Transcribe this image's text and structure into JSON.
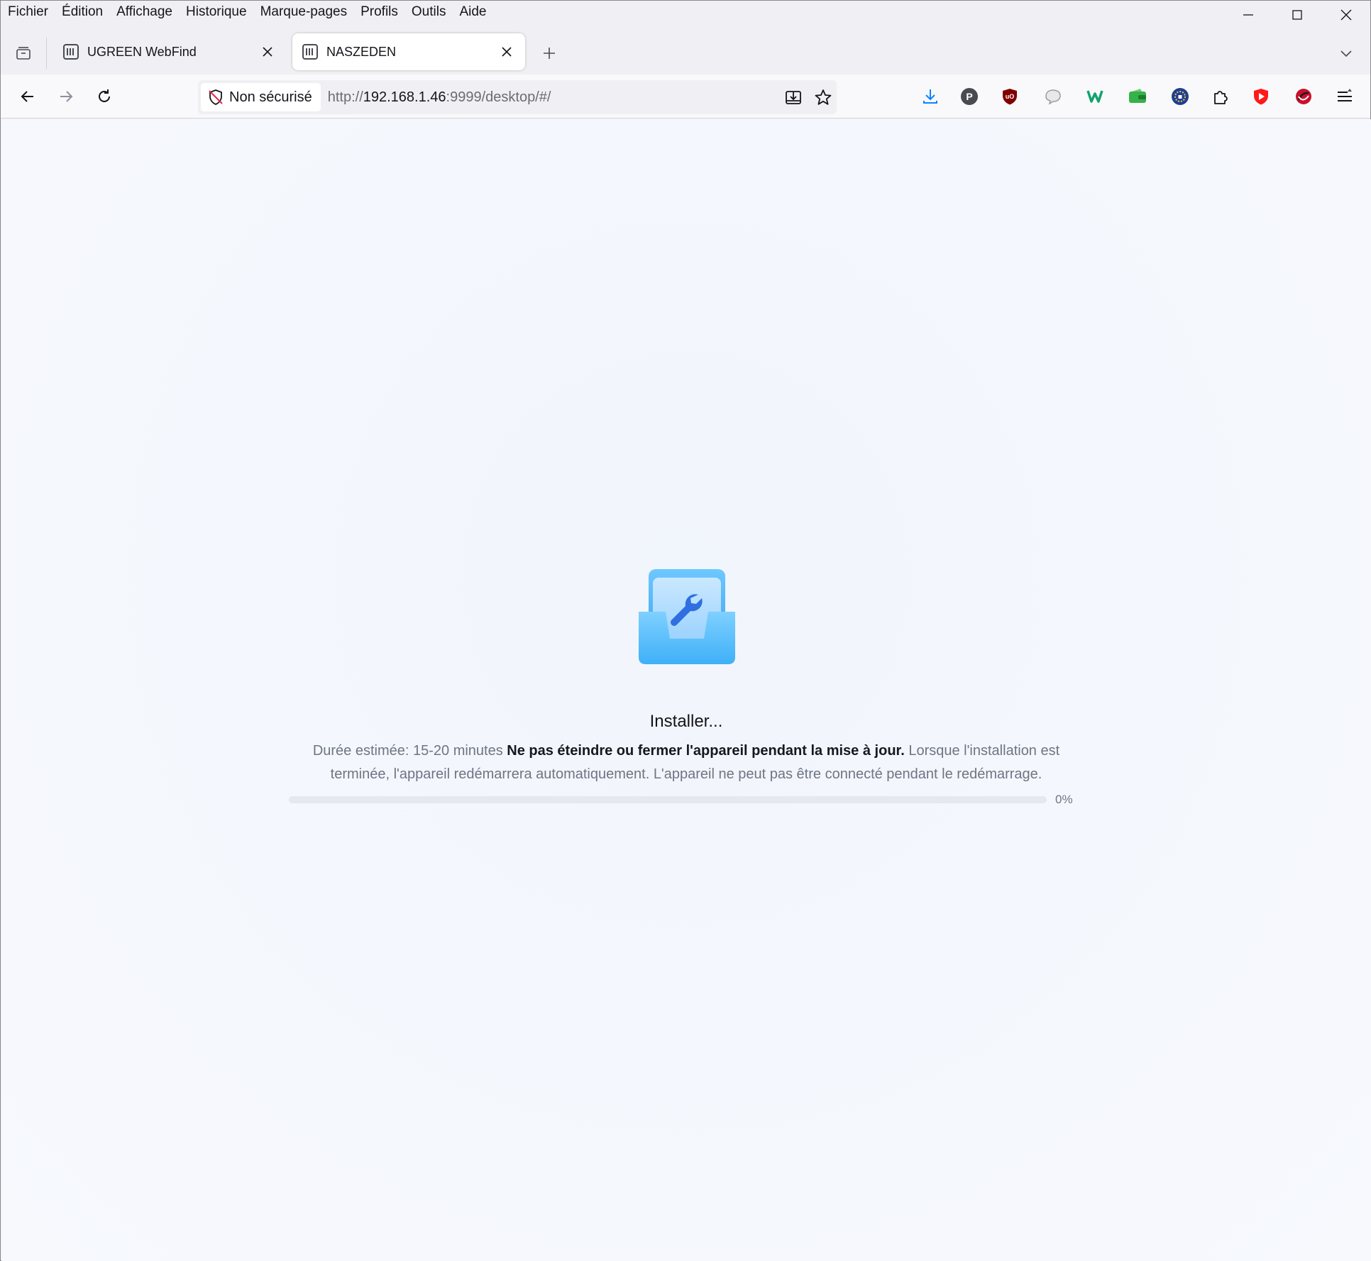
{
  "menubar": {
    "items": [
      "Fichier",
      "Édition",
      "Affichage",
      "Historique",
      "Marque-pages",
      "Profils",
      "Outils",
      "Aide"
    ]
  },
  "tabs": [
    {
      "title": "UGREEN WebFind",
      "active": false,
      "icon": "nas-favicon-icon"
    },
    {
      "title": "NASZEDEN",
      "active": true,
      "icon": "nas-favicon-icon"
    }
  ],
  "urlbar": {
    "security_label": "Non sécurisé",
    "url_scheme": "http://",
    "url_host": "192.168.1.46",
    "url_rest": ":9999/desktop/#/"
  },
  "extensions": [
    "download-icon",
    "pushbullet-icon",
    "ublock-origin-icon",
    "chat-bubble-icon",
    "bitwarden-icon",
    "wallet-icon",
    "vpn-icon",
    "extensions-puzzle-icon",
    "youtube-icon",
    "lastpass-icon",
    "app-menu-icon"
  ],
  "installer": {
    "title": "Installer...",
    "desc_prefix": "Durée estimée: 15-20 minutes ",
    "desc_bold": "Ne pas éteindre ou fermer l'appareil pendant la mise à jour.",
    "desc_suffix": " Lorsque l'installation est terminée, l'appareil redémarrera automatiquement. L'appareil ne peut pas être connecté pendant le redémarrage.",
    "progress_percent": 0,
    "progress_label": "0%"
  },
  "colors": {
    "accent": "#3b82f6",
    "icon_blue": "#4fb3f6"
  }
}
